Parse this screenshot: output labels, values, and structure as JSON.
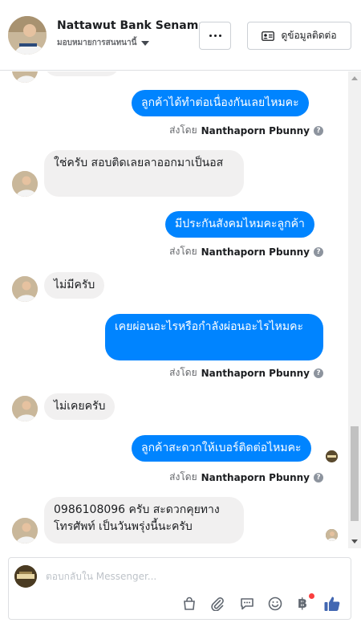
{
  "header": {
    "name": "Nattawut Bank Senama",
    "subtitle": "มอบหมายการสนทนานี้",
    "more_label": "...",
    "profile_label": "ดูข้อมูลติดต่อ"
  },
  "messages": [
    {
      "text": "ลูกค้าได้ทำต่อเนื่องกันเลยไหมคะ",
      "sender": "Nanthaporn Pbunny",
      "sent_prefix": "ส่งโดย"
    },
    {
      "text": "ใช่ครับ สอบติดเลยลาออกมาเป็นอส"
    },
    {
      "text": "มีประกันสังคมไหมคะลูกค้า",
      "sender": "Nanthaporn Pbunny",
      "sent_prefix": "ส่งโดย"
    },
    {
      "text": "ไม่มีครับ"
    },
    {
      "text": "เคยผ่อนอะไรหรือกำลังผ่อนอะไรไหมคะ",
      "sender": "Nanthaporn Pbunny",
      "sent_prefix": "ส่งโดย"
    },
    {
      "text": "ไม่เคยครับ"
    },
    {
      "text": "ลูกค้าสะดวกให้เบอร์ติดต่อไหมคะ",
      "sender": "Nanthaporn Pbunny",
      "sent_prefix": "ส่งโดย"
    },
    {
      "text": "0986108096 ครับ สะดวกคุยทางโทรศัพท์ เป็นวันพรุ่งนี้นะครับ"
    }
  ],
  "composer": {
    "placeholder": "ตอบกลับใน Messenger..."
  },
  "colors": {
    "outgoing": "#0084ff",
    "incoming": "#f1f0f0",
    "like": "#4267b2",
    "badge": "#fa3e3e"
  },
  "icons": [
    "more-icon",
    "contact-card-icon",
    "question-icon",
    "shopping-bag-icon",
    "attachment-icon",
    "saved-replies-icon",
    "emoji-icon",
    "payment-icon",
    "like-icon"
  ]
}
